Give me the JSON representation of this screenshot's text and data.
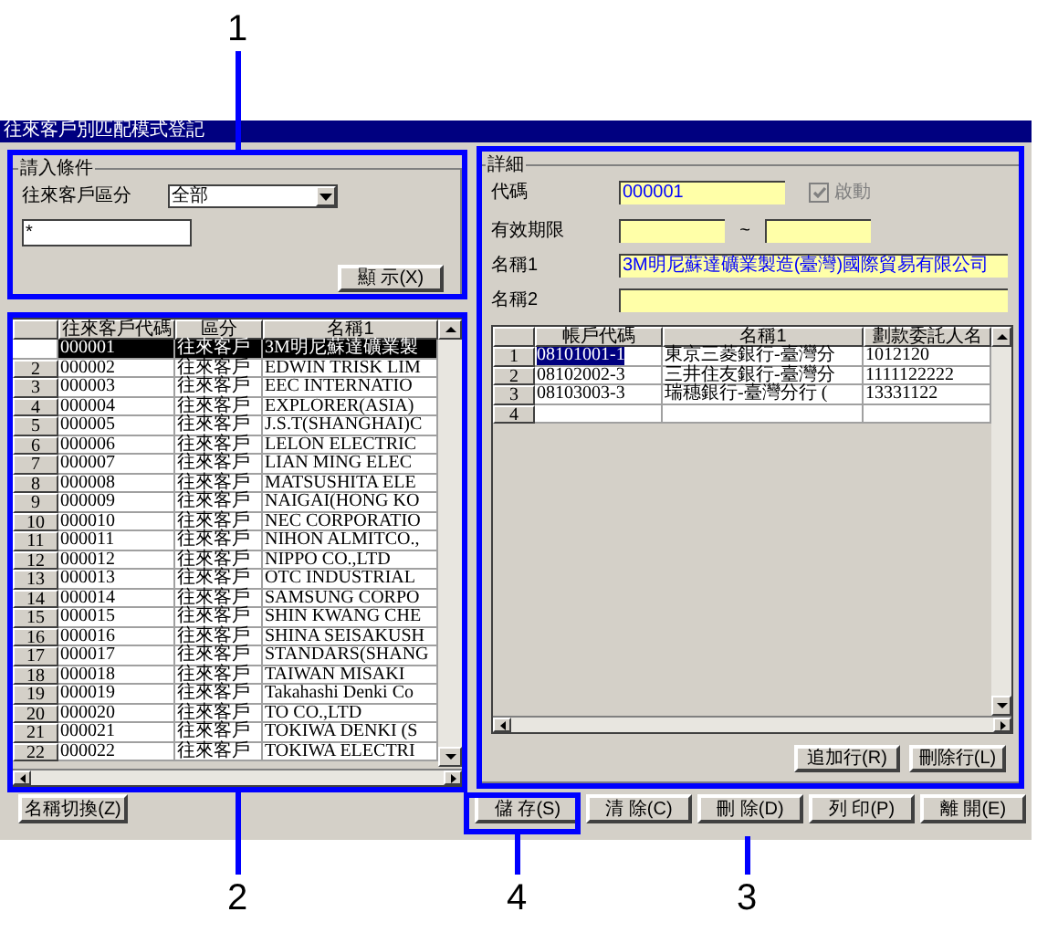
{
  "callouts": [
    {
      "label": "1"
    },
    {
      "label": "2"
    },
    {
      "label": "4"
    },
    {
      "label": "3"
    }
  ],
  "window": {
    "title": "往來客戶別匹配模式登記"
  },
  "filter": {
    "legend": "請入條件",
    "category_label": "往來客戶區分",
    "category_value": "全部",
    "search_value": "*",
    "show_button": "顯 示(X)"
  },
  "customer_grid": {
    "columns": [
      "往來客戶代碼",
      "區分",
      "名稱1"
    ],
    "rows": [
      {
        "number": "",
        "code": "000001",
        "category": "往來客戶",
        "name1": "3M明尼蘇達礦業製",
        "selected": true
      },
      {
        "number": "2",
        "code": "000002",
        "category": "往來客戶",
        "name1": "EDWIN TRISK LIM",
        "selected": false
      },
      {
        "number": "3",
        "code": "000003",
        "category": "往來客戶",
        "name1": "EEC INTERNATIO",
        "selected": false
      },
      {
        "number": "4",
        "code": "000004",
        "category": "往來客戶",
        "name1": "EXPLORER(ASIA)",
        "selected": false
      },
      {
        "number": "5",
        "code": "000005",
        "category": "往來客戶",
        "name1": "J.S.T(SHANGHAI)C",
        "selected": false
      },
      {
        "number": "6",
        "code": "000006",
        "category": "往來客戶",
        "name1": "LELON ELECTRIC",
        "selected": false
      },
      {
        "number": "7",
        "code": "000007",
        "category": "往來客戶",
        "name1": "LIAN MING ELEC",
        "selected": false
      },
      {
        "number": "8",
        "code": "000008",
        "category": "往來客戶",
        "name1": "MATSUSHITA ELE",
        "selected": false
      },
      {
        "number": "9",
        "code": "000009",
        "category": "往來客戶",
        "name1": "NAIGAI(HONG KO",
        "selected": false
      },
      {
        "number": "10",
        "code": "000010",
        "category": "往來客戶",
        "name1": "NEC CORPORATIO",
        "selected": false
      },
      {
        "number": "11",
        "code": "000011",
        "category": "往來客戶",
        "name1": "NIHON ALMITCO.,",
        "selected": false
      },
      {
        "number": "12",
        "code": "000012",
        "category": "往來客戶",
        "name1": "NIPPO CO.,LTD",
        "selected": false
      },
      {
        "number": "13",
        "code": "000013",
        "category": "往來客戶",
        "name1": "OTC INDUSTRIAL",
        "selected": false
      },
      {
        "number": "14",
        "code": "000014",
        "category": "往來客戶",
        "name1": "SAMSUNG CORPO",
        "selected": false
      },
      {
        "number": "15",
        "code": "000015",
        "category": "往來客戶",
        "name1": "SHIN KWANG CHE",
        "selected": false
      },
      {
        "number": "16",
        "code": "000016",
        "category": "往來客戶",
        "name1": "SHINA SEISAKUSH",
        "selected": false
      },
      {
        "number": "17",
        "code": "000017",
        "category": "往來客戶",
        "name1": "STANDARS(SHANG",
        "selected": false
      },
      {
        "number": "18",
        "code": "000018",
        "category": "往來客戶",
        "name1": "TAIWAN MISAKI",
        "selected": false
      },
      {
        "number": "19",
        "code": "000019",
        "category": "往來客戶",
        "name1": "Takahashi Denki Co",
        "selected": false
      },
      {
        "number": "20",
        "code": "000020",
        "category": "往來客戶",
        "name1": "TO CO.,LTD",
        "selected": false
      },
      {
        "number": "21",
        "code": "000021",
        "category": "往來客戶",
        "name1": "TOKIWA DENKI (S",
        "selected": false
      },
      {
        "number": "22",
        "code": "000022",
        "category": "往來客戶",
        "name1": "TOKIWA ELECTRI",
        "selected": false
      }
    ]
  },
  "name_toggle_button": "名稱切換(Z)",
  "detail": {
    "legend": "詳細",
    "code_label": "代碼",
    "code_value": "000001",
    "active_label": "啟動",
    "active_checked": true,
    "active_disabled": true,
    "period_label": "有效期限",
    "period_separator": "~",
    "name1_label": "名稱1",
    "name1_value": "3M明尼蘇達礦業製造(臺灣)國際貿易有限公司",
    "name2_label": "名稱2",
    "accounts_grid": {
      "columns": [
        "帳戶代碼",
        "名稱1",
        "劃款委託人名"
      ],
      "rows": [
        {
          "number": "1",
          "account": "08101001-1",
          "name1": "東京三菱銀行-臺灣分",
          "payer": "1012120",
          "selected": true
        },
        {
          "number": "2",
          "account": "08102002-3",
          "name1": "三井住友銀行-臺灣分",
          "payer": "1111122222",
          "selected": false
        },
        {
          "number": "3",
          "account": "08103003-3",
          "name1": "瑞穗銀行-臺灣分行 (",
          "payer": "13331122",
          "selected": false
        },
        {
          "number": "4",
          "selected": false
        }
      ]
    },
    "add_row_button": "追加行(R)",
    "delete_row_button": "刪除行(L)"
  },
  "actions": [
    "儲 存(S)",
    "清 除(C)",
    "刪 除(D)",
    "列 印(P)",
    "離 開(E)"
  ]
}
